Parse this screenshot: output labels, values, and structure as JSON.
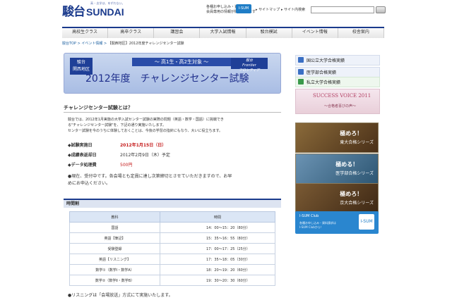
{
  "header": {
    "logo_kanji": "駿台",
    "logo_latin": "SUNDAI",
    "tagline": "高 – 志学は、ゆずれない。",
    "promo_line1": "各種お申し込み・資料請求",
    "promo_line2": "会員専用の情報が閲覧されます",
    "isum_label": "I-SUM",
    "sitemap": "サイトマップ",
    "site_search": "サイト内検索"
  },
  "global_nav": [
    "高校生クラス",
    "高卒クラス",
    "講習会",
    "大学入試情報",
    "駿台模試",
    "イベント情報",
    "校舎案内"
  ],
  "breadcrumb": {
    "home": "駿台TOP",
    "sep1": " > ",
    "events": "イベント情報",
    "sep2": " > ",
    "current": "【関西地区】2012年度チャレンジセンター試験"
  },
  "banner": {
    "badge_line1": "駿台",
    "badge_line2": "関西地区",
    "subtitle": "～ 高1生・高2生対象 ～",
    "frontier_line1": "駿台",
    "frontier_line2": "Frontier",
    "frontier_line3": "フロンティア",
    "title": "2012年度　チャレンジセンター試験"
  },
  "intro": {
    "heading": "チャレンジセンター試験とは？",
    "lines": [
      "駿台では、2012年1月実施の大学入試センター試験の実際の問題（英語・数学・国語）に挑戦でき",
      "る\"チャレンジセンター試験\"を、下記の通り実施いたします。",
      "センター試験を今のうちに体験しておくことは、今後の学習の指針にもなり、大いに役立ちます。"
    ]
  },
  "info": [
    {
      "label": "◆試験実施日",
      "value": "2012年1月15日（日）",
      "highlight": "red"
    },
    {
      "label": "◆成績表返却日",
      "value": "2012年2月9日（木）予定",
      "highlight": "none"
    },
    {
      "label": "◆データ処理費",
      "value": "500円",
      "highlight": "red"
    }
  ],
  "notice_lines": [
    "●現在、受付中です。各会場とも定員に達し次第締切とさせていただきますので、お早",
    "めにお申込ください。"
  ],
  "schedule": {
    "heading": "時間割",
    "col_subject": "教科",
    "col_time": "時間",
    "rows": [
      {
        "subject": "国語",
        "time": "14：00〜15：20（80分）"
      },
      {
        "subject": "英語【筆記】",
        "time": "15：35〜16：55（80分）"
      },
      {
        "subject": "受験登録",
        "time": "17：00〜17：25（25分）"
      },
      {
        "subject": "英語【リスニング】",
        "time": "17：35〜18：05（30分）"
      },
      {
        "subject": "数学①（数学Ⅰ・数学A）",
        "time": "18：20〜19：20（60分）"
      },
      {
        "subject": "数学②（数学Ⅱ・数学B）",
        "time": "19：30〜20：30（60分）"
      }
    ],
    "footnote": "●リスニングは「会場放送」方式にて実施いたします。"
  },
  "sidebar": {
    "links": [
      {
        "label": "国公立大学合格実績",
        "color": "#3a6fc4"
      },
      {
        "label": "医学部合格実績",
        "color": "#3a6fc4"
      },
      {
        "label": "私立大学合格実績",
        "color": "#3a9a4a"
      }
    ],
    "success_voice_title": "SUCCESS VOICE 2011",
    "success_voice_sub": "～合格者喜びの声～",
    "goku": [
      {
        "line1": "極めろ！",
        "line2": "東大合格シリーズ",
        "bg": "#6b4a24"
      },
      {
        "line1": "極める！",
        "line2": "医学部合格シリーズ",
        "bg": "#3d6a8a"
      },
      {
        "line1": "極めろ！",
        "line2": "京大合格シリーズ",
        "bg": "#5a3e24"
      }
    ],
    "isum_title": "I-SUM Club",
    "isum_line1": "各種お申し込み・資料請求は",
    "isum_line2": "I-SUM Clubから！",
    "isum_tag": "I-SUM"
  }
}
